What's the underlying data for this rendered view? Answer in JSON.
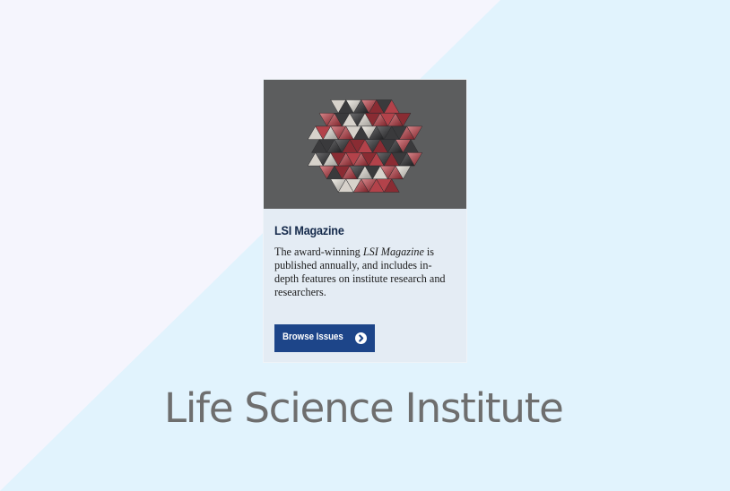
{
  "background": {
    "light_color": "#f5f5fd",
    "blue_color": "#e1f3fd"
  },
  "card": {
    "image": {
      "icon": "geodesic-sculpture-image",
      "background_color": "#5c5d5e"
    },
    "title": "LSI Magazine",
    "description": {
      "prefix": "The award-winning ",
      "emphasis": "LSI Magazine",
      "suffix": " is published annually, and includes in-depth features on institute research and researchers."
    },
    "button": {
      "label": "Browse Issues",
      "icon": "chevron-right-circle-icon",
      "color": "#1d4589"
    }
  },
  "site_name": "Life Science Institute"
}
